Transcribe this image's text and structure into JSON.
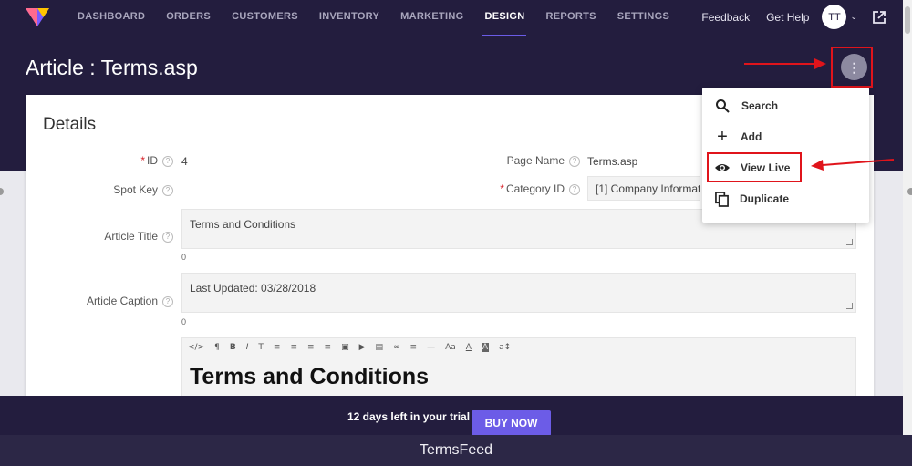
{
  "nav": {
    "items": [
      "DASHBOARD",
      "ORDERS",
      "CUSTOMERS",
      "INVENTORY",
      "MARKETING",
      "DESIGN",
      "REPORTS",
      "SETTINGS"
    ],
    "active": "DESIGN",
    "feedback": "Feedback",
    "get_help": "Get Help",
    "avatar_initials": "TT",
    "logo_icon": "brand-logo-icon",
    "external_icon": "external-link-icon"
  },
  "page": {
    "title": "Article : Terms.asp"
  },
  "details": {
    "title": "Details",
    "id_label": "ID",
    "id_value": "4",
    "spot_key_label": "Spot Key",
    "page_name_label": "Page Name",
    "page_name_value": "Terms.asp",
    "category_id_label": "Category ID",
    "category_id_value": "[1] Company Information",
    "article_title_label": "Article Title",
    "article_title_value": "Terms and Conditions",
    "article_title_count": "0",
    "article_caption_label": "Article Caption",
    "article_caption_value": "Last Updated: 03/28/2018",
    "article_caption_count": "0",
    "editor_heading": "Terms and Conditions",
    "toolbar": [
      "</>",
      "¶",
      "B",
      "I",
      "T",
      "≡",
      "≡",
      "≡",
      "≡",
      "▣",
      "▶",
      "▤",
      "∞",
      "≡",
      "—",
      "Aa",
      "A",
      "A",
      "a↕"
    ]
  },
  "menu": {
    "items": [
      {
        "label": "Search",
        "icon": "search-icon",
        "glyph": "⌕"
      },
      {
        "label": "Add",
        "icon": "plus-icon",
        "glyph": "+"
      },
      {
        "label": "View Live",
        "icon": "eye-icon",
        "glyph": "◉"
      },
      {
        "label": "Duplicate",
        "icon": "duplicate-icon",
        "glyph": "❐"
      }
    ]
  },
  "trial": {
    "text": "12 days left in your trial",
    "button": "BUY NOW"
  },
  "caption": "TermsFeed",
  "colors": {
    "nav_bg": "#231d3e",
    "accent": "#6c5ce7",
    "annotation": "#e0141b"
  }
}
